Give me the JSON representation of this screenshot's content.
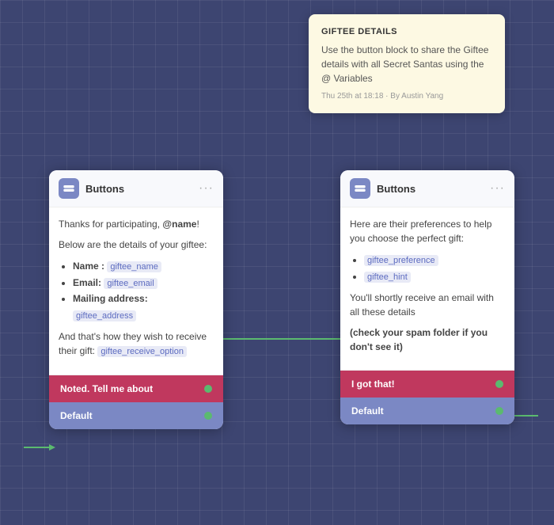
{
  "note_card": {
    "title": "GIFTEE DETAILS",
    "body": "Use the button block to share the Giftee details with all Secret Santas using the @ Variables",
    "meta": "Thu 25th at 18:18 · By Austin Yang"
  },
  "left_card": {
    "header": {
      "title": "Buttons",
      "icon_label": "buttons-icon",
      "dots_label": "···"
    },
    "paragraph1": "Thanks for participating, @name!",
    "paragraph2": "Below are the details of your giftee:",
    "list_items": [
      {
        "label": "Name : ",
        "var": "giftee_name"
      },
      {
        "label": "Email: ",
        "var": "giftee_email"
      },
      {
        "label": "Mailing address: ",
        "var": "giftee_address"
      }
    ],
    "paragraph3": "And that's how they wish to receive their gift:",
    "var_receive": "giftee_receive_option",
    "btn_primary": "Noted. Tell me about",
    "btn_secondary": "Default"
  },
  "right_card": {
    "header": {
      "title": "Buttons",
      "icon_label": "buttons-icon",
      "dots_label": "···"
    },
    "paragraph1": "Here are their preferences to help you choose the perfect gift:",
    "list_items": [
      {
        "var": "giftee_preference"
      },
      {
        "var": "giftee_hint"
      }
    ],
    "paragraph2": "You'll shortly receive an email with all these details",
    "paragraph3": "(check your spam folder if you don't see it)",
    "btn_primary": "I got that!",
    "btn_secondary": "Default"
  },
  "colors": {
    "bg": "#3d4571",
    "primary_btn": "#c0385e",
    "secondary_btn": "#7b88c4",
    "dot_green": "#5bba6f",
    "var_bg": "#e8eaf6",
    "var_text": "#5c6bc0"
  }
}
